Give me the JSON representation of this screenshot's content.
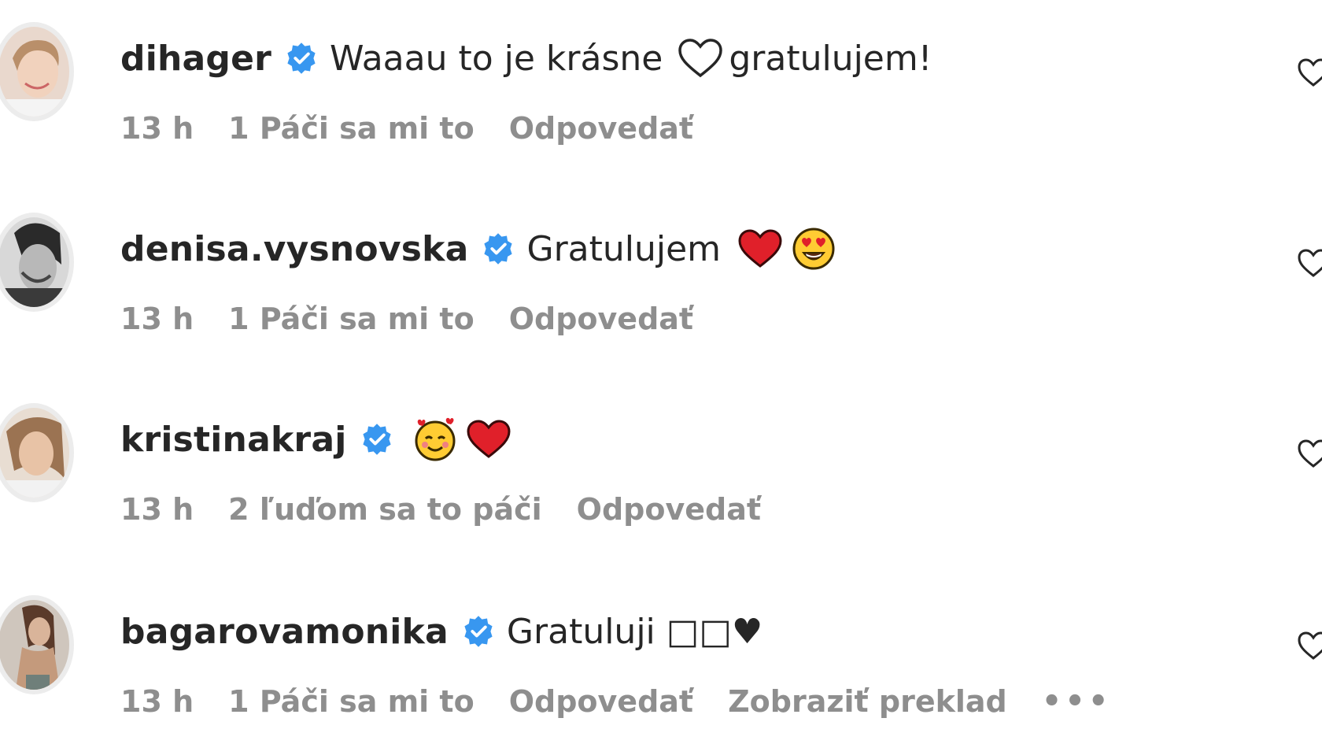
{
  "comments": [
    {
      "username": "dihager",
      "text": "Waaau to je krásne",
      "text_suffix": " gratulujem!",
      "time": "13 h",
      "likes": "1 Páči sa mi to",
      "reply": "Odpovedať"
    },
    {
      "username": "denisa.vysnovska",
      "text": "Gratulujem",
      "time": "13 h",
      "likes": "1 Páči sa mi to",
      "reply": "Odpovedať"
    },
    {
      "username": "kristinakraj",
      "text": "",
      "time": "13 h",
      "likes": "2 ľuďom sa to páči",
      "reply": "Odpovedať"
    },
    {
      "username": "bagarovamonika",
      "text": "Gratuluji □□♥",
      "time": "13 h",
      "likes": "1 Páči sa mi to",
      "reply": "Odpovedať",
      "translate": "Zobraziť preklad",
      "more": "•••"
    }
  ],
  "colors": {
    "text": "#262626",
    "meta": "#8e8e8e",
    "verified": "#3897f0",
    "heart_red": "#e0245e"
  },
  "icons": [
    "verified-badge-icon",
    "like-heart-icon",
    "white-heart-emoji",
    "red-heart-emoji",
    "heart-eyes-emoji",
    "smiling-hearts-emoji"
  ]
}
